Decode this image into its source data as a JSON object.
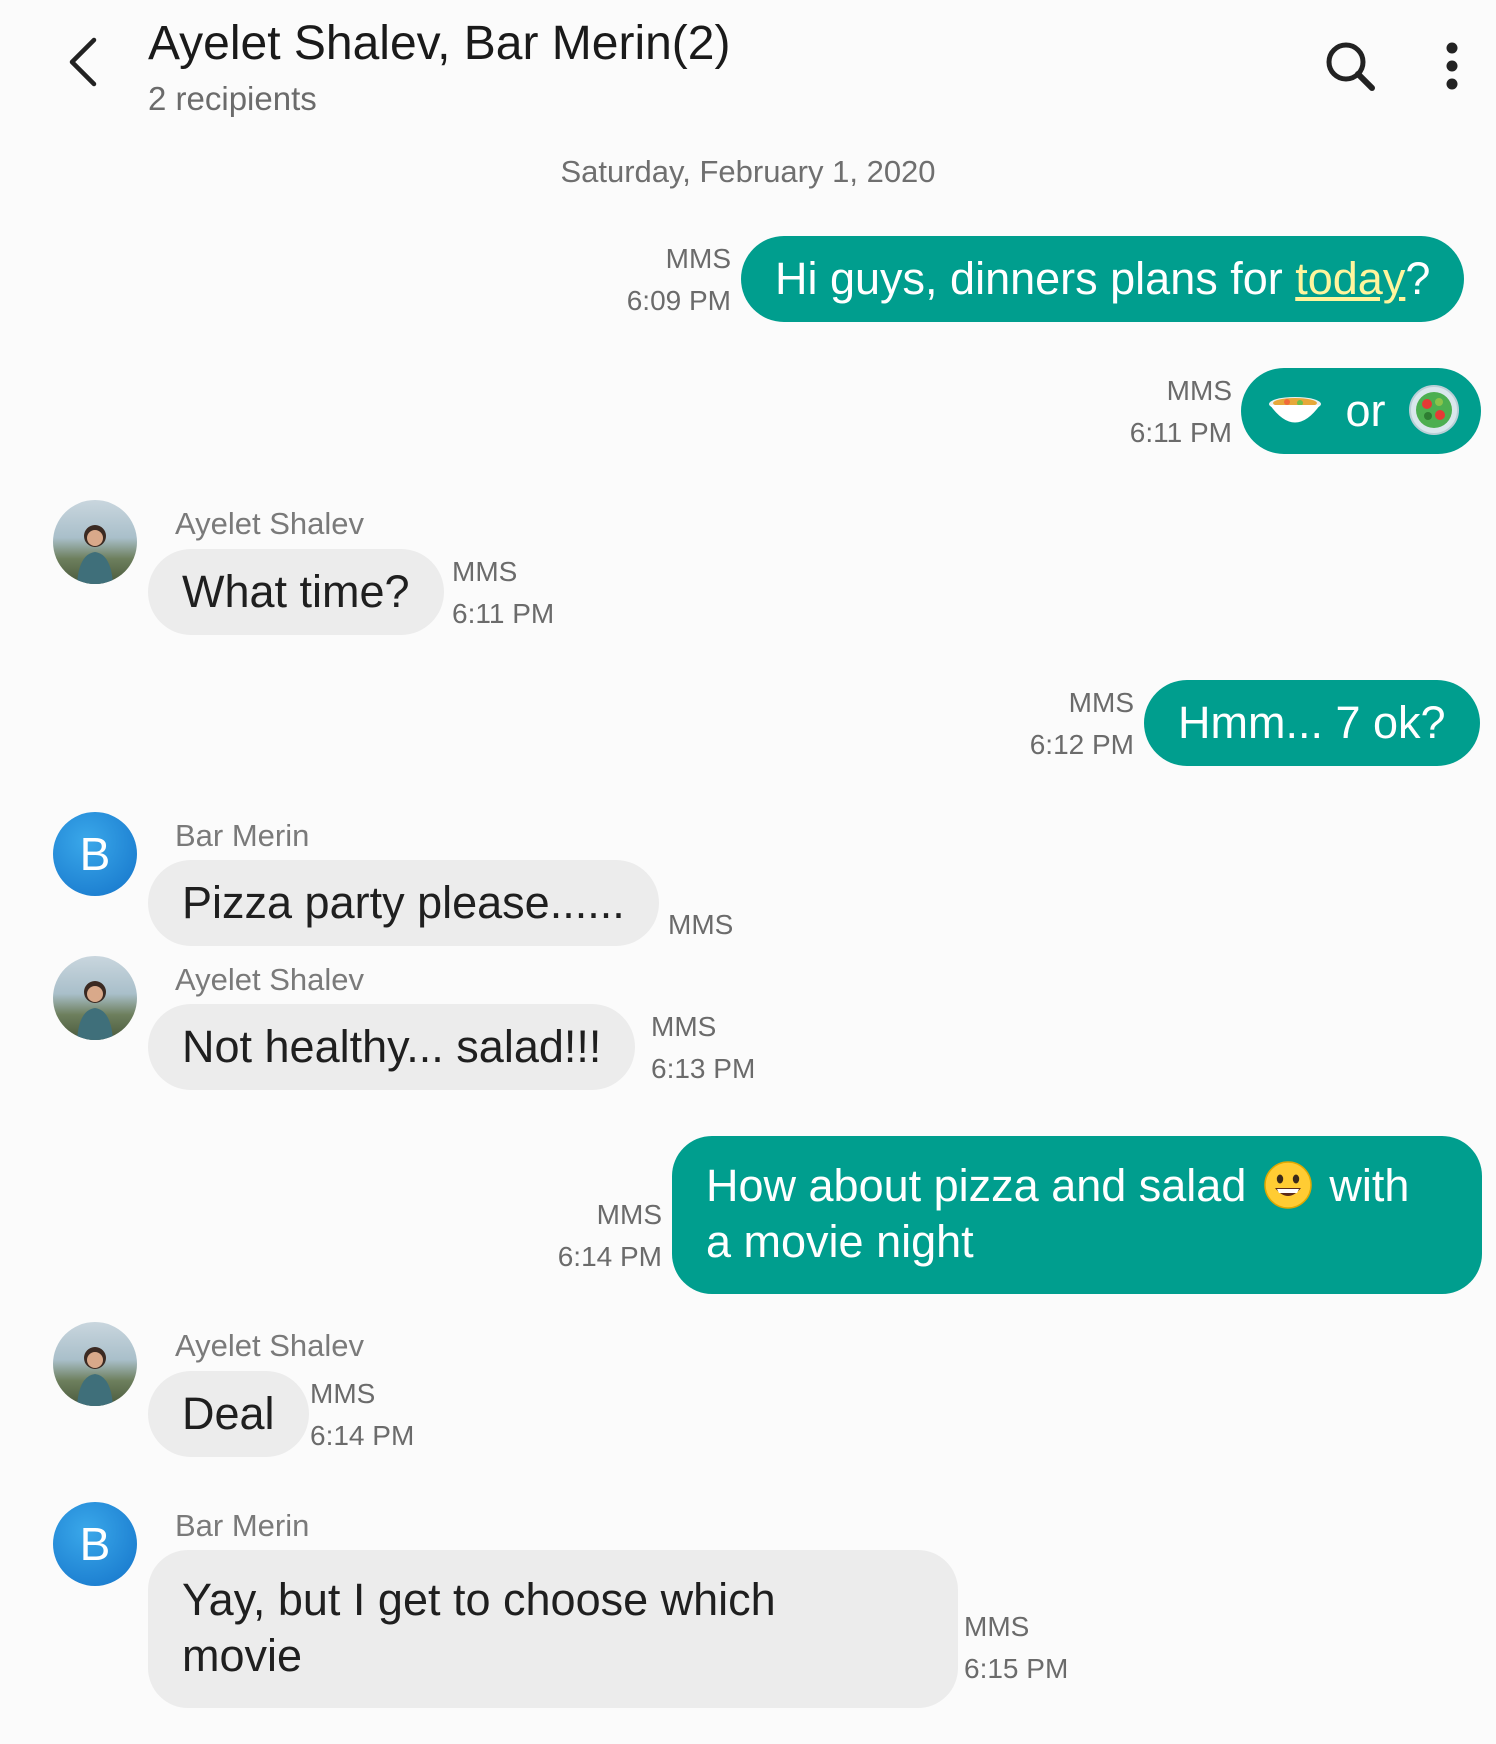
{
  "header": {
    "title": "Ayelet Shalev, Bar Merin(2)",
    "subtitle": "2 recipients"
  },
  "conversation": {
    "date": "Saturday, February 1, 2020",
    "messages": [
      {
        "direction": "outgoing",
        "text_before": "Hi guys, dinners plans for ",
        "link": "today",
        "text_after": "?",
        "type": "MMS",
        "time": "6:09 PM"
      },
      {
        "direction": "outgoing",
        "emoji_1": "bowl-with-soup",
        "text": "or",
        "emoji_2": "salad",
        "type": "MMS",
        "time": "6:11 PM"
      },
      {
        "direction": "incoming",
        "sender": "Ayelet Shalev",
        "text": "What time?",
        "type": "MMS",
        "time": "6:11 PM"
      },
      {
        "direction": "outgoing",
        "text": "Hmm... 7 ok?",
        "type": "MMS",
        "time": "6:12 PM"
      },
      {
        "direction": "incoming",
        "sender": "Bar Merin",
        "avatar_letter": "B",
        "text": "Pizza party please......",
        "type": "MMS"
      },
      {
        "direction": "incoming",
        "sender": "Ayelet Shalev",
        "text": "Not healthy... salad!!!",
        "type": "MMS",
        "time": "6:13 PM"
      },
      {
        "direction": "outgoing",
        "text_before": "How about pizza and salad",
        "emoji": "grinning-face",
        "text_after": " with",
        "line2": "a movie night",
        "type": "MMS",
        "time": "6:14 PM"
      },
      {
        "direction": "incoming",
        "sender": "Ayelet Shalev",
        "text": "Deal",
        "type": "MMS",
        "time": "6:14 PM"
      },
      {
        "direction": "incoming",
        "sender": "Bar Merin",
        "avatar_letter": "B",
        "line1": "Yay, but I get to choose which",
        "line2": "movie",
        "type": "MMS",
        "time": "6:15 PM"
      }
    ]
  },
  "colors": {
    "outgoing_bubble": "#009e8e",
    "incoming_bubble": "#ececec",
    "link": "#fff59d",
    "avatar_b": "#1e88e5"
  },
  "icons": [
    "back-arrow-icon",
    "search-icon",
    "more-vertical-icon"
  ]
}
